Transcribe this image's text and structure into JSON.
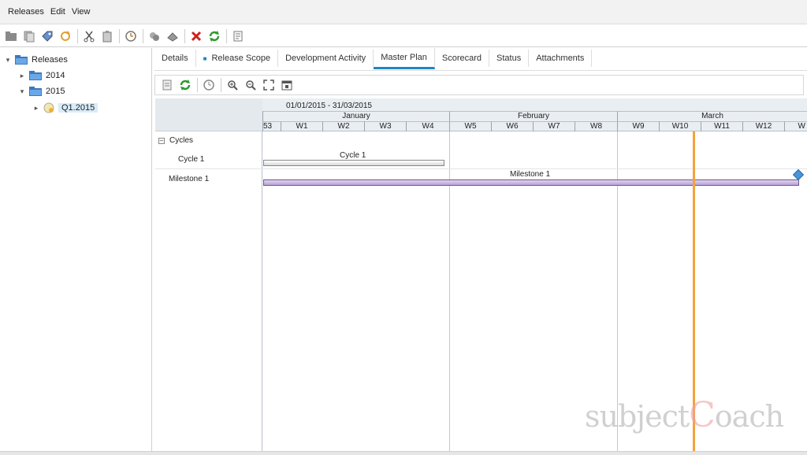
{
  "menu": [
    "Releases",
    "Edit",
    "View"
  ],
  "toolbar_icons": [
    "new-folder-icon",
    "copy-icon",
    "tag-icon",
    "refresh-small-icon",
    "cut-icon",
    "paste-icon",
    "clock-icon",
    "group-icon",
    "eraser-icon",
    "delete-icon",
    "refresh-icon",
    "notes-icon"
  ],
  "tree": {
    "root": "Releases",
    "y2014": "2014",
    "y2015": "2015",
    "q1": "Q1.2015"
  },
  "tabs": [
    "Details",
    "Release Scope",
    "Development Activity",
    "Master Plan",
    "Scorecard",
    "Status",
    "Attachments"
  ],
  "active_tab": "Master Plan",
  "gantt": {
    "date_range": "01/01/2015 - 31/03/2015",
    "months": [
      "January",
      "February",
      "March"
    ],
    "weeks": [
      "53",
      "W1",
      "W2",
      "W3",
      "W4",
      "W5",
      "W6",
      "W7",
      "W8",
      "W9",
      "W10",
      "W11",
      "W12",
      "W"
    ],
    "group_label": "Cycles",
    "rows": [
      {
        "label": "Cycle 1",
        "bar_label": "Cycle 1"
      },
      {
        "label": "Milestone 1",
        "bar_label": "Milestone 1"
      }
    ],
    "today_color": "#f3a33a"
  },
  "watermark": {
    "part1": "subject",
    "part2": "C",
    "part3": "oach"
  }
}
